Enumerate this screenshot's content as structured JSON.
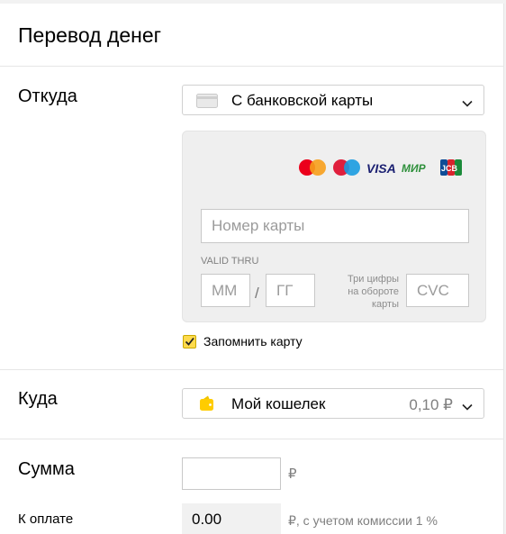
{
  "header": {
    "title": "Перевод денег"
  },
  "from": {
    "label": "Откуда",
    "source": "С банковской карты",
    "card_brands": [
      "mastercard",
      "maestro",
      "VISA",
      "МИР",
      "JCB"
    ],
    "card_number_placeholder": "Номер карты",
    "valid_thru": "VALID THRU",
    "month_placeholder": "ММ",
    "slash": "/",
    "year_placeholder": "ГГ",
    "cvc_hint_lines": [
      "Три цифры",
      "на обороте",
      "карты"
    ],
    "cvc_placeholder": "CVC",
    "remember_label": "Запомнить карту",
    "remember_checked": true
  },
  "to": {
    "label": "Куда",
    "wallet": "Мой кошелек",
    "balance": "0,10 ₽"
  },
  "amount": {
    "label": "Сумма",
    "value": "",
    "currency": "₽"
  },
  "pay": {
    "label": "К оплате",
    "value": "0.00",
    "commission_note": "₽, с учетом комиссии 1 %"
  },
  "colors": {
    "accent_yellow": "#ffdb4d",
    "border": "#d0d0d0",
    "card_bg": "#efefef",
    "muted_text": "#7f7f7f"
  }
}
